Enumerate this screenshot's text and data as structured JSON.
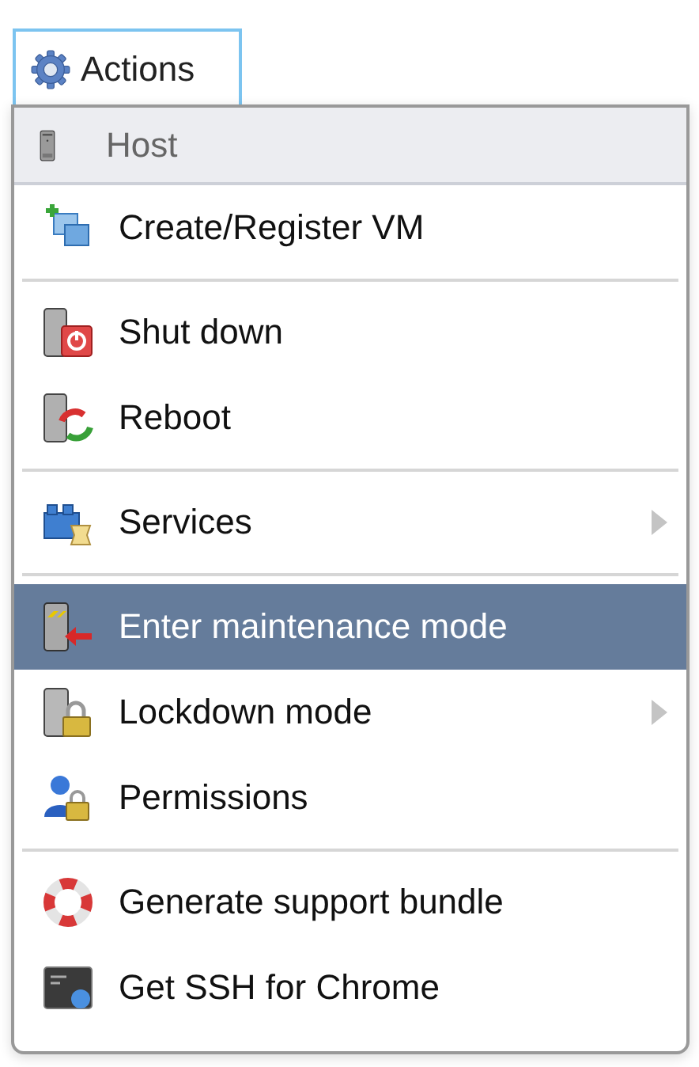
{
  "actions_button": {
    "label": "Actions"
  },
  "menu": {
    "header": "Host",
    "groups": [
      [
        {
          "label": "Create/Register VM",
          "selected": false,
          "submenu": false
        }
      ],
      [
        {
          "label": "Shut down",
          "selected": false,
          "submenu": false
        },
        {
          "label": "Reboot",
          "selected": false,
          "submenu": false
        }
      ],
      [
        {
          "label": "Services",
          "selected": false,
          "submenu": true
        }
      ],
      [
        {
          "label": "Enter maintenance mode",
          "selected": true,
          "submenu": false
        },
        {
          "label": "Lockdown mode",
          "selected": false,
          "submenu": true
        },
        {
          "label": "Permissions",
          "selected": false,
          "submenu": false
        }
      ],
      [
        {
          "label": "Generate support bundle",
          "selected": false,
          "submenu": false
        },
        {
          "label": "Get SSH for Chrome",
          "selected": false,
          "submenu": false
        }
      ]
    ]
  }
}
